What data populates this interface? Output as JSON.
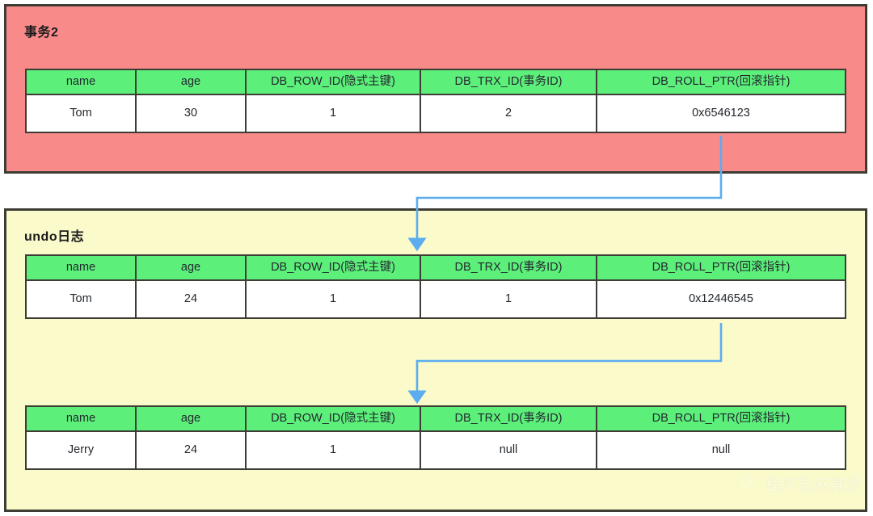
{
  "columns": [
    "name",
    "age",
    "DB_ROW_ID(隐式主键)",
    "DB_TRX_ID(事务ID)",
    "DB_ROLL_PTR(回滚指针)"
  ],
  "panels": {
    "transaction": {
      "title": "事务2",
      "background_color": "#f98a8a",
      "border_color": "#3d3d35"
    },
    "undo_log": {
      "title": "undo日志",
      "background_color": "#fbfacb",
      "border_color": "#3d3d35"
    }
  },
  "tables": {
    "current_record": {
      "headers": [
        "name",
        "age",
        "DB_ROW_ID(隐式主键)",
        "DB_TRX_ID(事务ID)",
        "DB_ROLL_PTR(回滚指针)"
      ],
      "row": {
        "name": "Tom",
        "age": "30",
        "db_row_id": "1",
        "db_trx_id": "2",
        "db_roll_ptr": "0x6546123"
      }
    },
    "undo_version_1": {
      "headers": [
        "name",
        "age",
        "DB_ROW_ID(隐式主键)",
        "DB_TRX_ID(事务ID)",
        "DB_ROLL_PTR(回滚指针)"
      ],
      "row": {
        "name": "Tom",
        "age": "24",
        "db_row_id": "1",
        "db_trx_id": "1",
        "db_roll_ptr": "0x12446545"
      }
    },
    "undo_version_2": {
      "headers": [
        "name",
        "age",
        "DB_ROW_ID(隐式主键)",
        "DB_TRX_ID(事务ID)",
        "DB_ROLL_PTR(回滚指针)"
      ],
      "row": {
        "name": "Jerry",
        "age": "24",
        "db_row_id": "1",
        "db_trx_id": "null",
        "db_roll_ptr": "null"
      }
    }
  },
  "arrows": [
    {
      "name": "roll-ptr-to-undo-1",
      "from": "current_record.db_roll_ptr",
      "to": "undo_version_1",
      "color": "#5badf0"
    },
    {
      "name": "roll-ptr-to-undo-2",
      "from": "undo_version_1.db_roll_ptr",
      "to": "undo_version_2",
      "color": "#5badf0"
    }
  ],
  "colors": {
    "header_green": "#5cf07b",
    "cell_white": "#ffffff",
    "arrow_blue": "#5badf0",
    "text_dark": "#23282e",
    "border_dark": "#3d3d35"
  },
  "watermark": {
    "text": "程序员麻辣烫",
    "icon": "wechat-icon"
  }
}
